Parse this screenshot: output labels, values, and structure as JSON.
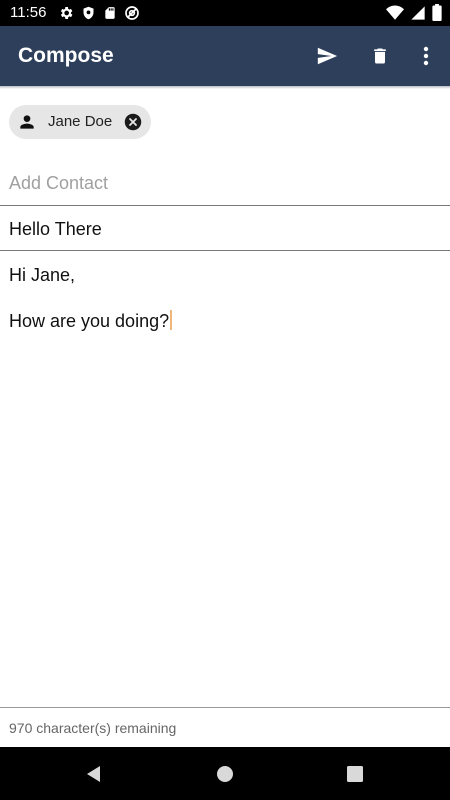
{
  "status_bar": {
    "time": "11:56",
    "left_icons": [
      "gear-icon",
      "shield-icon",
      "sd-card-icon",
      "at-sign-icon"
    ],
    "right_icons": [
      "wifi-icon",
      "signal-icon",
      "battery-icon"
    ]
  },
  "app_bar": {
    "title": "Compose",
    "actions": [
      "send-icon",
      "delete-icon",
      "more-vert-icon"
    ],
    "color": "#2e3f5c"
  },
  "recipients": [
    {
      "name": "Jane Doe",
      "icon": "person-icon"
    }
  ],
  "add_contact": {
    "value": "",
    "placeholder": "Add Contact"
  },
  "subject": {
    "value": "Hello There"
  },
  "message": {
    "lines": [
      "Hi Jane,",
      "How are you doing?"
    ]
  },
  "footer": {
    "remaining_text": "970 character(s) remaining"
  },
  "nav_bar": {
    "buttons": [
      "back-icon",
      "home-icon",
      "recents-icon"
    ]
  }
}
